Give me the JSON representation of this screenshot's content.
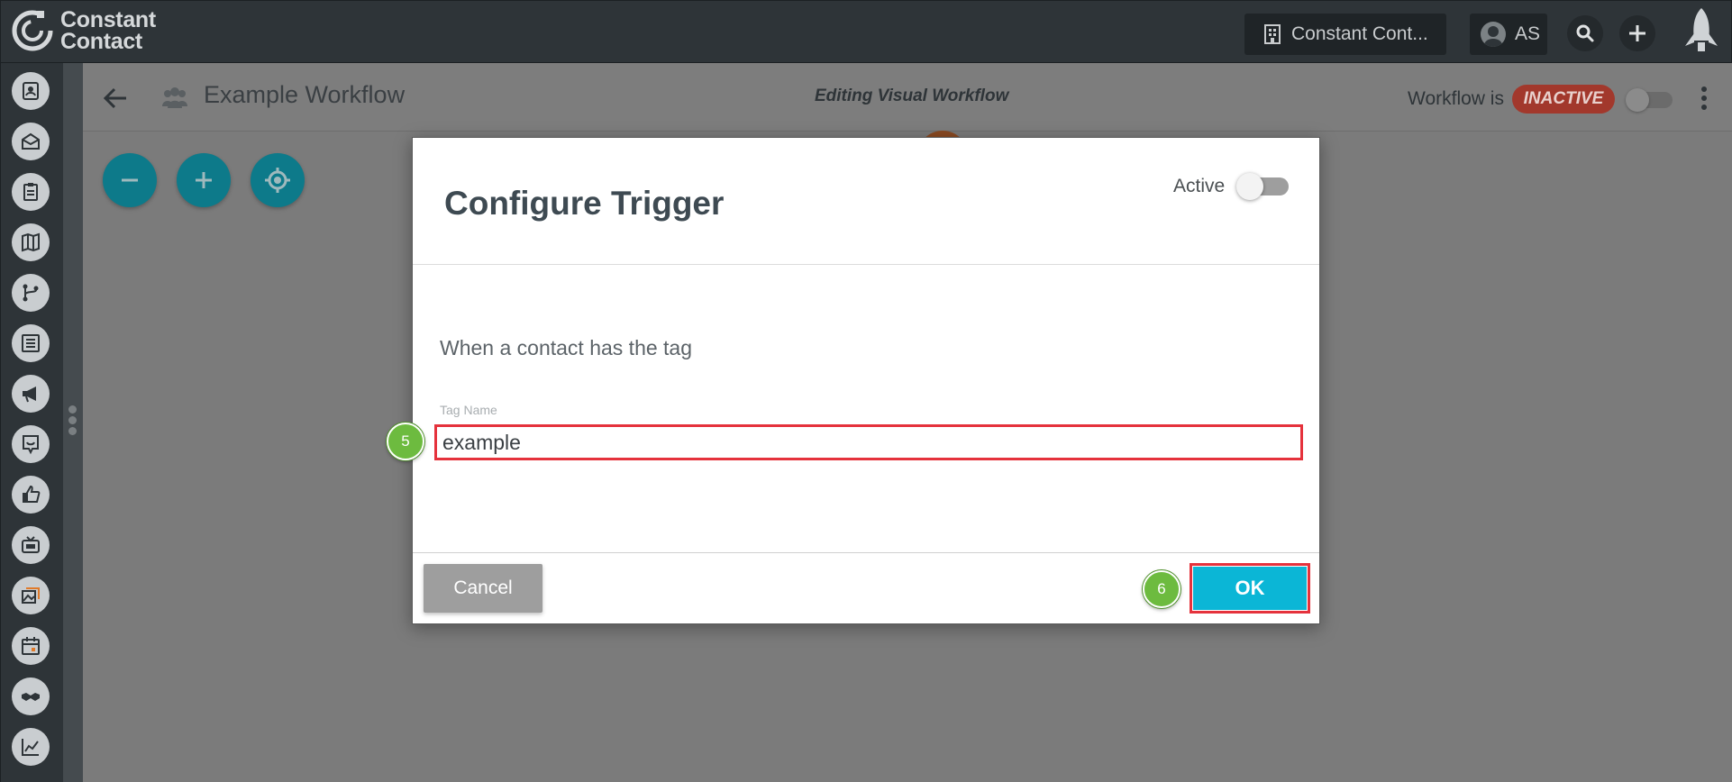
{
  "brand": {
    "line1": "Constant",
    "line2": "Contact"
  },
  "topbar": {
    "account_name": "Constant Cont...",
    "user_initials": "AS",
    "icons": [
      "building-icon",
      "user-avatar-icon",
      "search-icon",
      "plus-icon",
      "rocket-icon"
    ]
  },
  "sidebar": {
    "items": [
      "contacts-icon",
      "email-icon",
      "clipboard-icon",
      "map-icon",
      "workflow-icon",
      "list-icon",
      "megaphone-icon",
      "survey-icon",
      "thumbs-up-icon",
      "tv-icon",
      "images-icon",
      "calendar-icon",
      "handshake-icon",
      "chart-icon"
    ]
  },
  "page": {
    "title": "Example Workflow",
    "editing_label": "Editing Visual Workflow",
    "status_prefix": "Workflow is",
    "status": "INACTIVE",
    "status_color": "#a2382c"
  },
  "canvas_controls": [
    "zoom-out",
    "zoom-in",
    "recenter"
  ],
  "modal": {
    "title": "Configure Trigger",
    "active_label": "Active",
    "description": "When a contact has the tag",
    "tag_label": "Tag Name",
    "tag_value": "example",
    "cancel_label": "Cancel",
    "ok_label": "OK",
    "accent_color": "#0bb6d6"
  },
  "steps": {
    "tag_field": "5",
    "ok_button": "6"
  }
}
